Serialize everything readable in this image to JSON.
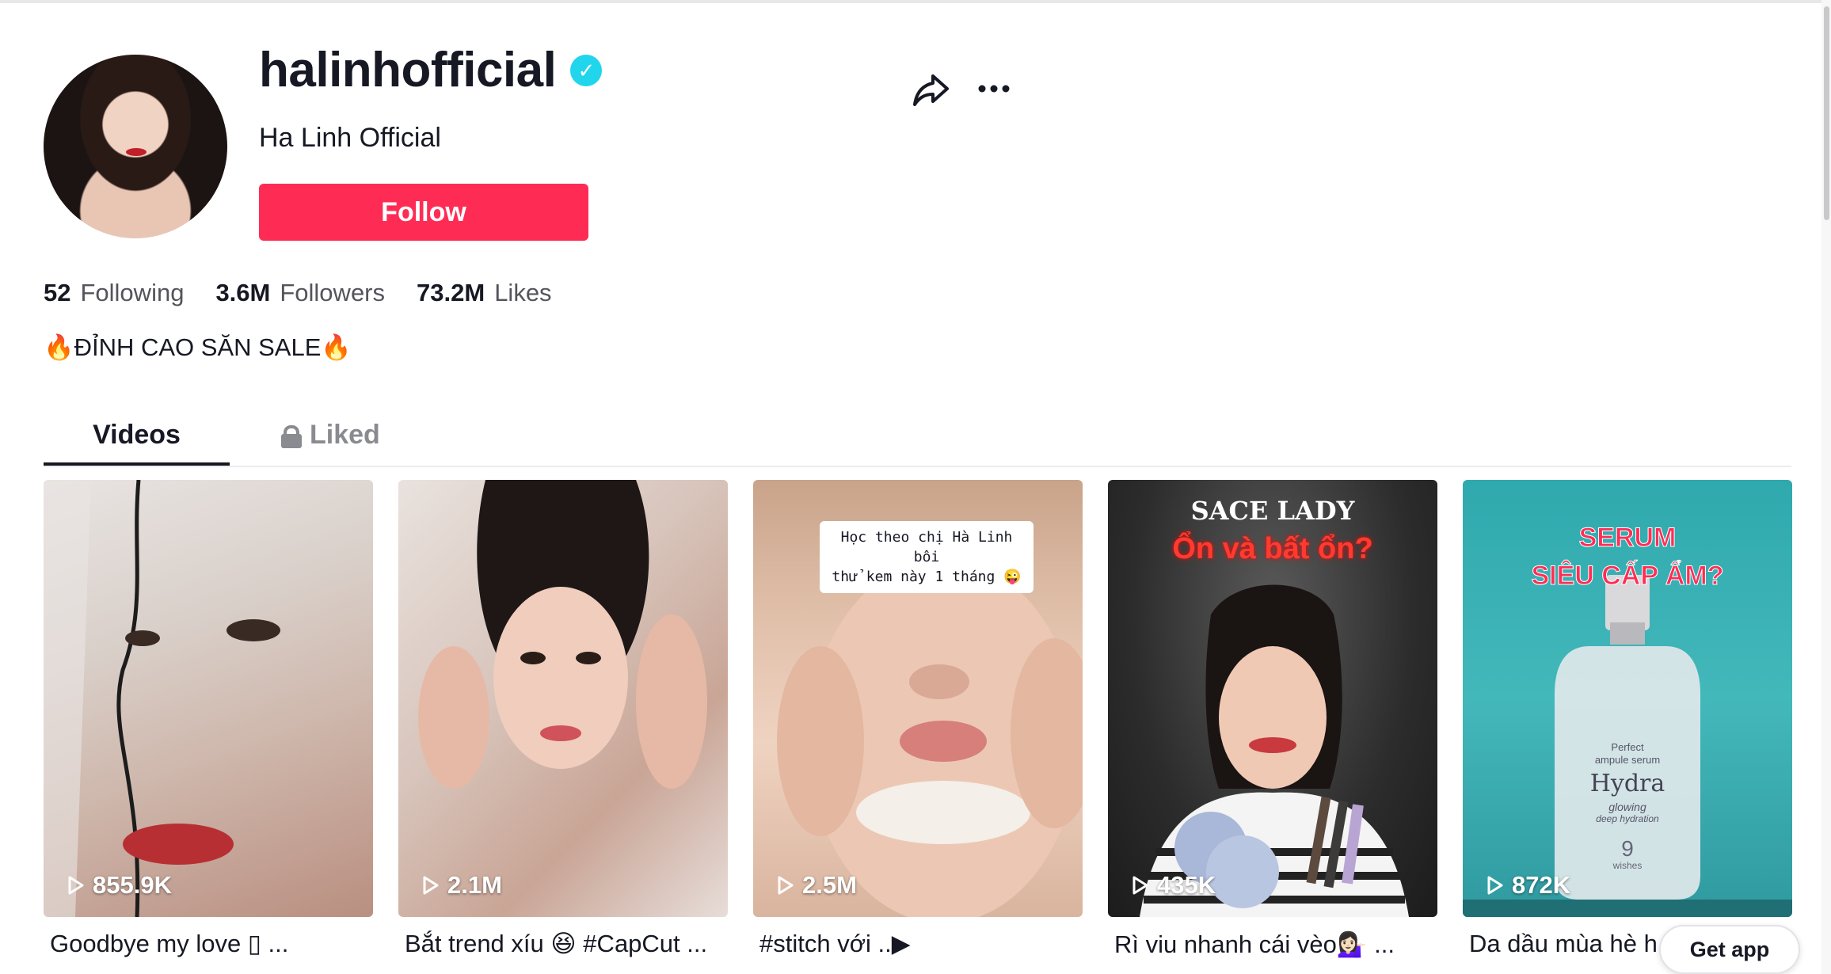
{
  "profile": {
    "username": "halinhofficial",
    "display_name": "Ha Linh Official",
    "follow_label": "Follow",
    "bio": "🔥ĐỈNH CAO SĂN SALE🔥",
    "verified": true
  },
  "stats": [
    {
      "value": "52",
      "label": "Following"
    },
    {
      "value": "3.6M",
      "label": "Followers"
    },
    {
      "value": "73.2M",
      "label": "Likes"
    }
  ],
  "tabs": [
    {
      "label": "Videos",
      "active": true
    },
    {
      "label": "Liked",
      "locked": true
    }
  ],
  "videos": [
    {
      "views": "855.9K",
      "caption": "Goodbye my love ▯ ...",
      "overlay": []
    },
    {
      "views": "2.1M",
      "caption": "Bắt trend xíu 😆 #CapCut ...",
      "overlay": []
    },
    {
      "views": "2.5M",
      "caption": "#stitch với ..▶",
      "overlay": [
        "Học theo chị Hà Linh bôi",
        "thử kem này 1 tháng 😜"
      ]
    },
    {
      "views": "435K",
      "caption": "Rì viu nhanh cái vèo💁🏻‍♀️ ...",
      "overlay": [
        "SACE LADY",
        "Ổn và bất ổn?"
      ]
    },
    {
      "views": "872K",
      "caption": "Da dầu mùa hè h",
      "overlay": [
        "SERUM",
        "SIÊU CẤP ẨM?",
        "Perfect",
        "ampule serum",
        "Hydra",
        "glowing",
        "deep hydration",
        "9",
        "wishes"
      ]
    }
  ],
  "get_app_label": "Get app",
  "colors": {
    "accent": "#fe2c55",
    "verified": "#20d5ec"
  },
  "icons": [
    "share-icon",
    "more-icon",
    "verified-icon",
    "lock-icon",
    "play-icon"
  ]
}
